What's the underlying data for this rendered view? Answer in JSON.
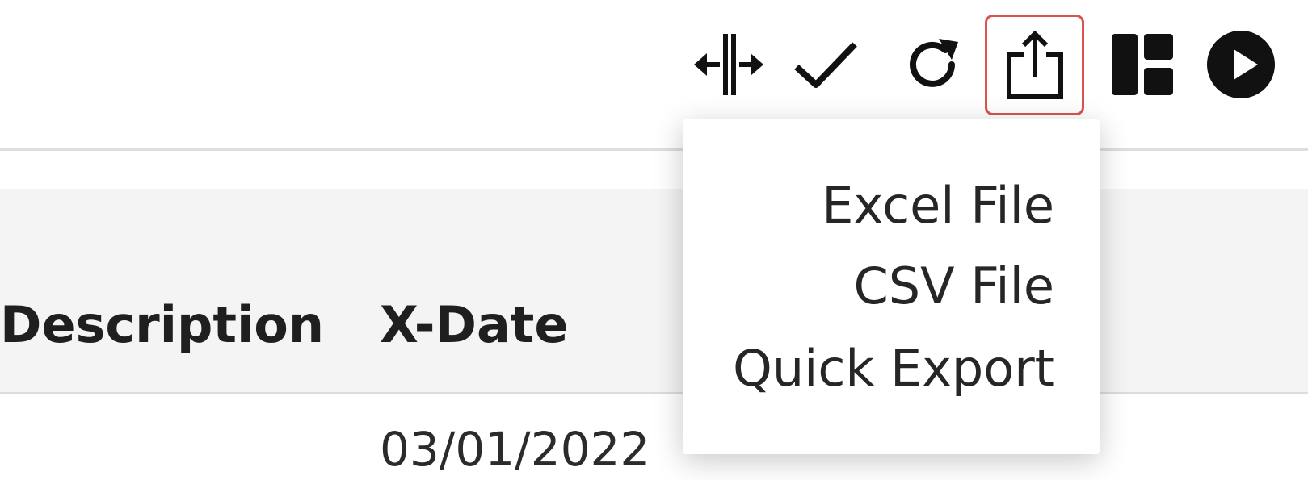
{
  "toolbar": {
    "buttons": [
      {
        "name": "column-resize",
        "icon": "column-resize-icon"
      },
      {
        "name": "confirm",
        "icon": "checkmark-icon"
      },
      {
        "name": "refresh",
        "icon": "refresh-icon"
      },
      {
        "name": "export",
        "icon": "export-share-icon",
        "active": true
      },
      {
        "name": "layout",
        "icon": "layout-grid-icon"
      },
      {
        "name": "play",
        "icon": "play-circle-icon"
      }
    ],
    "active_border_color": "#d9534f"
  },
  "export_menu": {
    "items": [
      "Excel File",
      "CSV File",
      "Quick Export"
    ]
  },
  "table": {
    "columns": [
      "Description",
      "X-Date"
    ],
    "rows": [
      {
        "description": "",
        "x_date": "03/01/2022"
      }
    ]
  }
}
